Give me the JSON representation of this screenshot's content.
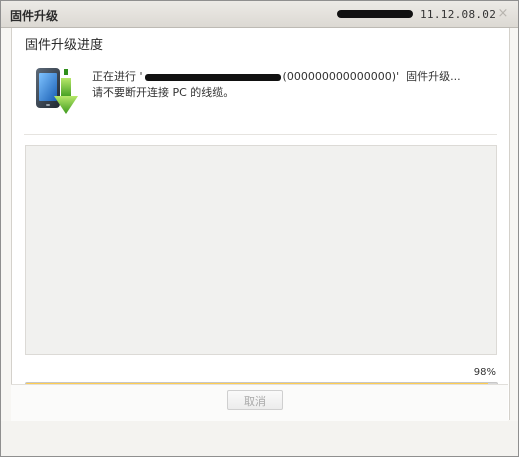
{
  "window": {
    "title": "固件升级",
    "version": "11.12.08.02",
    "close_glyph": "×"
  },
  "progress": {
    "heading": "固件升级进度",
    "status_prefix": "正在进行 '",
    "status_suffix": "(000000000000000)'  固件升级...",
    "status_line2": "请不要断开连接 PC 的线缆。",
    "percent_label": "98%",
    "percent_value": 98
  },
  "buttons": {
    "cancel": "取消"
  },
  "icons": {
    "device": "phone-download-icon",
    "close": "close-icon"
  },
  "colors": {
    "progress_fill": "#f2a511",
    "progress_track": "#d9d9d9"
  }
}
